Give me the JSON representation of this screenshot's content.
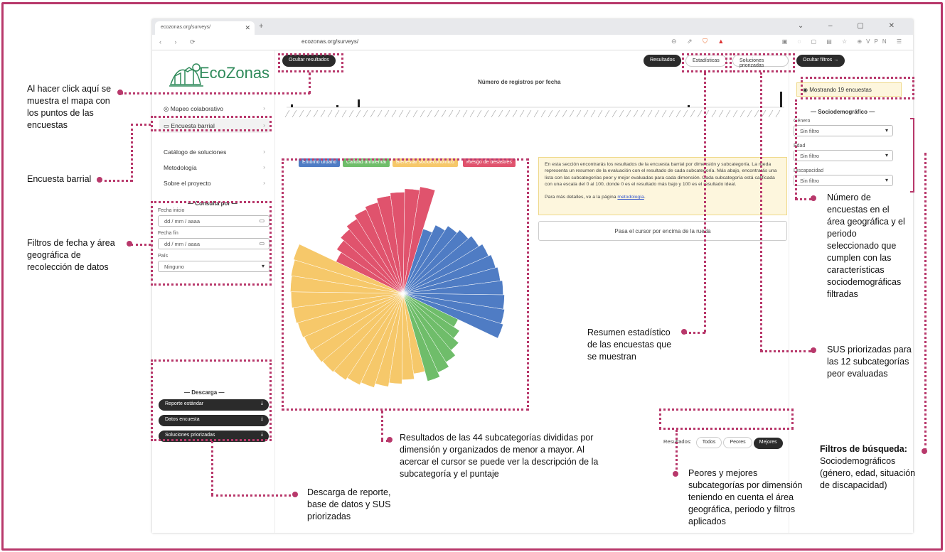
{
  "browser": {
    "tab_title": "ecozonas.org/surveys/",
    "url": "ecozonas.org/surveys/"
  },
  "sidebar": {
    "logo_text": "EcoZonas",
    "nav": [
      {
        "label": "Mapeo colaborativo"
      },
      {
        "label": "Encuesta barrial"
      },
      {
        "label": "Catálogo de soluciones"
      },
      {
        "label": "Metodología"
      },
      {
        "label": "Sobre el proyecto"
      }
    ],
    "consulta_title": "— Consulta por —",
    "fecha_inicio_label": "Fecha inicio",
    "fecha_inicio_value": "dd / mm / aaaa",
    "fecha_fin_label": "Fecha fin",
    "fecha_fin_value": "dd / mm / aaaa",
    "pais_label": "País",
    "pais_value": "Ninguno",
    "descarga_title": "— Descarga —",
    "downloads": [
      "Reporte estándar",
      "Datos encuesta",
      "Soluciones priorizadas"
    ]
  },
  "main": {
    "hide_results_button": "Ocultar resultados",
    "results_button": "Resultados",
    "stats_button": "Estadísticas",
    "solutions_button": "Soluciones priorizadas",
    "timeline_title": "Número de registros por fecha",
    "legend": [
      {
        "label": "Entorno urbano",
        "color": "#4f7cc4"
      },
      {
        "label": "Calidad ambiental",
        "color": "#6fbd6a"
      },
      {
        "label": "Bienestar socioeconómico",
        "color": "#f6c86a"
      },
      {
        "label": "Riesgo de desastres",
        "color": "#e0536d"
      }
    ],
    "info_text": "En esta sección encontrarás los resultados de la encuesta barrial por dimensión y subcategoría. La rueda representa un resumen de la evaluación con el resultado de cada subcategoría. Más abajo, encontrarás una lista con las subcategorías peor y mejor evaluadas para cada dimensión. Cada subcategoría está calificada con una escala del 0 al 100, donde 0 es el resultado más bajo y 100 es el resultado ideal.",
    "info_more": "Para más detalles, ve a la página",
    "info_link": "metodología",
    "hover_text": "Pasa el cursor por encima de la rueda",
    "results_label": "Resultados:",
    "filter_all": "Todos",
    "filter_worst": "Peores",
    "filter_best": "Mejores"
  },
  "rightpanel": {
    "hide_filters_button": "Ocultar filtros",
    "showing_text": "Mostrando 19 encuestas",
    "socio_title": "— Sociodemográfico —",
    "genero_label": "Género",
    "edad_label": "Edad",
    "discapacidad_label": "Discapacidad",
    "sin_filtro": "Sin filtro"
  },
  "annotations": {
    "map_points": "Al hacer click aquí se muestra el mapa con los puntos de las encuestas",
    "survey": "Encuesta barrial",
    "date_filters": "Filtros de fecha y área geográfica de recolección de datos",
    "download": "Descarga de reporte, base de datos y SUS priorizadas",
    "wheel": "Resultados de las 44 subcategorías divididas por dimensión y organizados de menor a mayor. Al acercar el cursor se puede ver la descripción de la subcategoría y el puntaje",
    "stats": "Resumen estadístico de las encuestas que se muestran",
    "worst_best": "Peores y mejores subcategorías por dimensión teniendo en cuenta el área geográfica, periodo y filtros aplicados",
    "sus": "SUS priorizadas para las 12 subcategorías peor evaluadas",
    "count": "Número de encuestas en el área geográfica y el periodo seleccionado que cumplen con las características sociodemográficas filtradas",
    "filters_title": "Filtros de búsqueda:",
    "filters_body": "Sociodemográficos (género, edad, situación de discapacidad)"
  }
}
